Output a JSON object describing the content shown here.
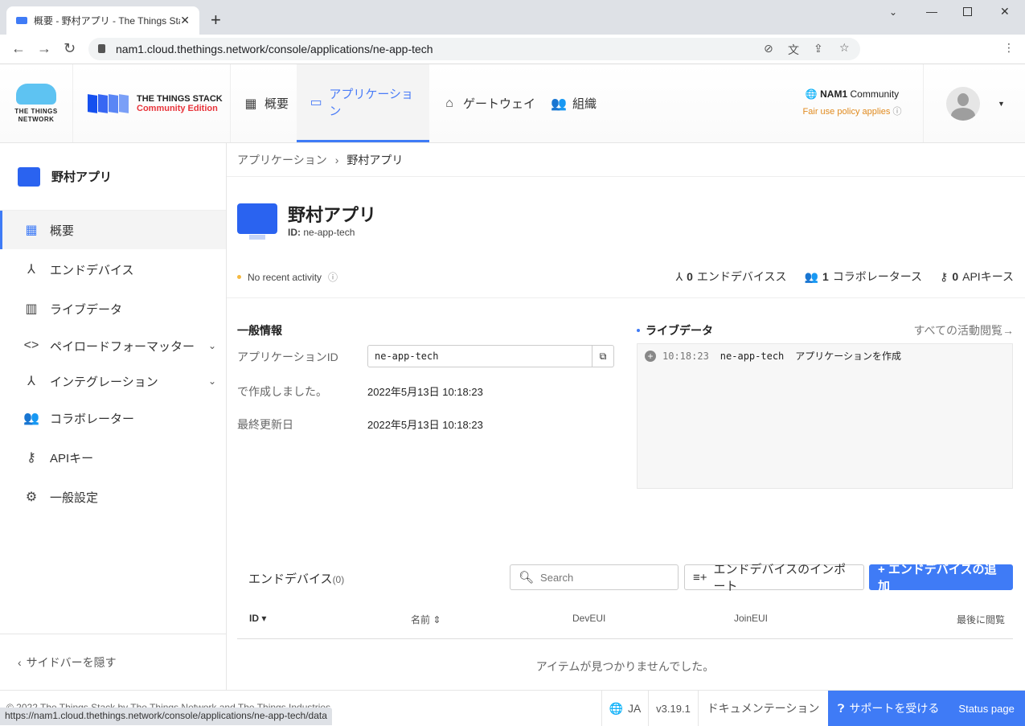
{
  "browser": {
    "tab_title": "概要 - 野村アプリ - The Things Sta",
    "url": "nam1.cloud.thethings.network/console/applications/ne-app-tech",
    "status_url": "https://nam1.cloud.thethings.network/console/applications/ne-app-tech/data"
  },
  "header": {
    "ttn_logo": "THE THINGS NETWORK",
    "stack_title": "THE THINGS STACK",
    "stack_edition": "Community Edition",
    "nav": [
      {
        "label": "概要",
        "icon": "dashboard-icon"
      },
      {
        "label": "アプリケーション",
        "icon": "application-icon",
        "active": true
      },
      {
        "label": "ゲートウェイ",
        "icon": "router-icon"
      },
      {
        "label": "組織",
        "icon": "group-icon"
      }
    ],
    "cluster_bold": "NAM1",
    "cluster": "Community",
    "fair_use": "Fair use policy applies"
  },
  "sidebar": {
    "app_name": "野村アプリ",
    "items": [
      {
        "label": "概要",
        "icon": "dashboard-icon",
        "active": true
      },
      {
        "label": "エンドデバイス",
        "icon": "device-hub-icon"
      },
      {
        "label": "ライブデータ",
        "icon": "bar-chart-icon"
      },
      {
        "label": "ペイロードフォーマッター",
        "icon": "code-icon",
        "expandable": true
      },
      {
        "label": "インテグレーション",
        "icon": "merge-icon",
        "expandable": true
      },
      {
        "label": "コラボレーター",
        "icon": "group-icon"
      },
      {
        "label": "APIキー",
        "icon": "key-icon"
      },
      {
        "label": "一般設定",
        "icon": "gear-icon"
      }
    ],
    "hide_label": "サイドバーを隠す"
  },
  "breadcrumb": [
    "アプリケーション",
    "野村アプリ"
  ],
  "app": {
    "title": "野村アプリ",
    "id_label": "ID:",
    "id": "ne-app-tech",
    "activity": "No recent activity",
    "stats": [
      {
        "count": "0",
        "label": "エンドデバイスス"
      },
      {
        "count": "1",
        "label": "コラボレータース"
      },
      {
        "count": "0",
        "label": "APIキース"
      }
    ]
  },
  "general": {
    "heading": "一般情報",
    "app_id_label": "アプリケーションID",
    "app_id_value": "ne-app-tech",
    "created_label": "で作成しました。",
    "created_value": "2022年5月13日 10:18:23",
    "updated_label": "最終更新日",
    "updated_value": "2022年5月13日 10:18:23"
  },
  "live": {
    "heading": "ライブデータ",
    "see_all": "すべての活動閲覧→",
    "events": [
      {
        "time": "10:18:23",
        "id": "ne-app-tech",
        "text": "アプリケーションを作成"
      }
    ]
  },
  "devices": {
    "title": "エンドデバイス",
    "count": "(0)",
    "search_placeholder": "Search",
    "import_label": "エンドデバイスのインポート",
    "add_label": "+ エンドデバイスの追加",
    "columns": [
      "ID",
      "名前",
      "DevEUI",
      "JoinEUI",
      "最後に閲覧"
    ],
    "empty": "アイテムが見つかりませんでした。"
  },
  "footer": {
    "copyright": "© 2022 The Things Stack by The Things Network and The Things Industries",
    "lang": "JA",
    "version": "v3.19.1",
    "docs": "ドキュメンテーション",
    "support": "サポートを受ける",
    "status": "Status page"
  },
  "colors": {
    "accent": "#3f7bf6",
    "edition": "#e8333a",
    "fair_use": "#e08a1e"
  }
}
